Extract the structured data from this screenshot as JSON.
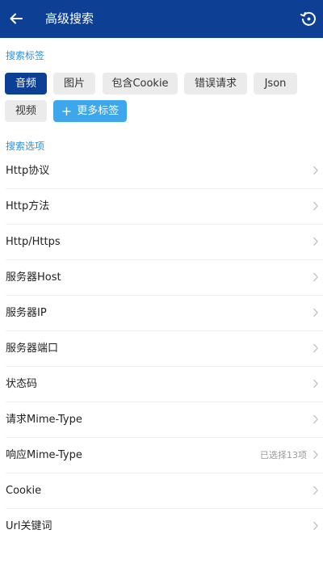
{
  "header": {
    "title": "高级搜索",
    "back_icon": "arrow-left-icon",
    "reset_icon": "history-reset-icon",
    "bg_color": "#0d3f94"
  },
  "tags_section": {
    "title": "搜索标签",
    "tags": [
      {
        "label": "音频",
        "active": true
      },
      {
        "label": "图片",
        "active": false
      },
      {
        "label": "包含Cookie",
        "active": false
      },
      {
        "label": "错误请求",
        "active": false
      },
      {
        "label": "Json",
        "active": false
      },
      {
        "label": "视频",
        "active": false
      }
    ],
    "more_label": "更多标签",
    "more_icon": "plus-icon"
  },
  "options_section": {
    "title": "搜索选项",
    "items": [
      {
        "label": "Http协议",
        "value": ""
      },
      {
        "label": "Http方法",
        "value": ""
      },
      {
        "label": "Http/Https",
        "value": ""
      },
      {
        "label": "服务器Host",
        "value": ""
      },
      {
        "label": "服务器IP",
        "value": ""
      },
      {
        "label": "服务器端口",
        "value": ""
      },
      {
        "label": "状态码",
        "value": ""
      },
      {
        "label": "请求Mime-Type",
        "value": ""
      },
      {
        "label": "响应Mime-Type",
        "value": "已选择13项"
      },
      {
        "label": "Cookie",
        "value": ""
      },
      {
        "label": "Url关键词",
        "value": ""
      }
    ]
  },
  "colors": {
    "accent": "#2f8fd6",
    "more_button": "#3ea6ea",
    "tag_bg": "#ebebeb"
  }
}
